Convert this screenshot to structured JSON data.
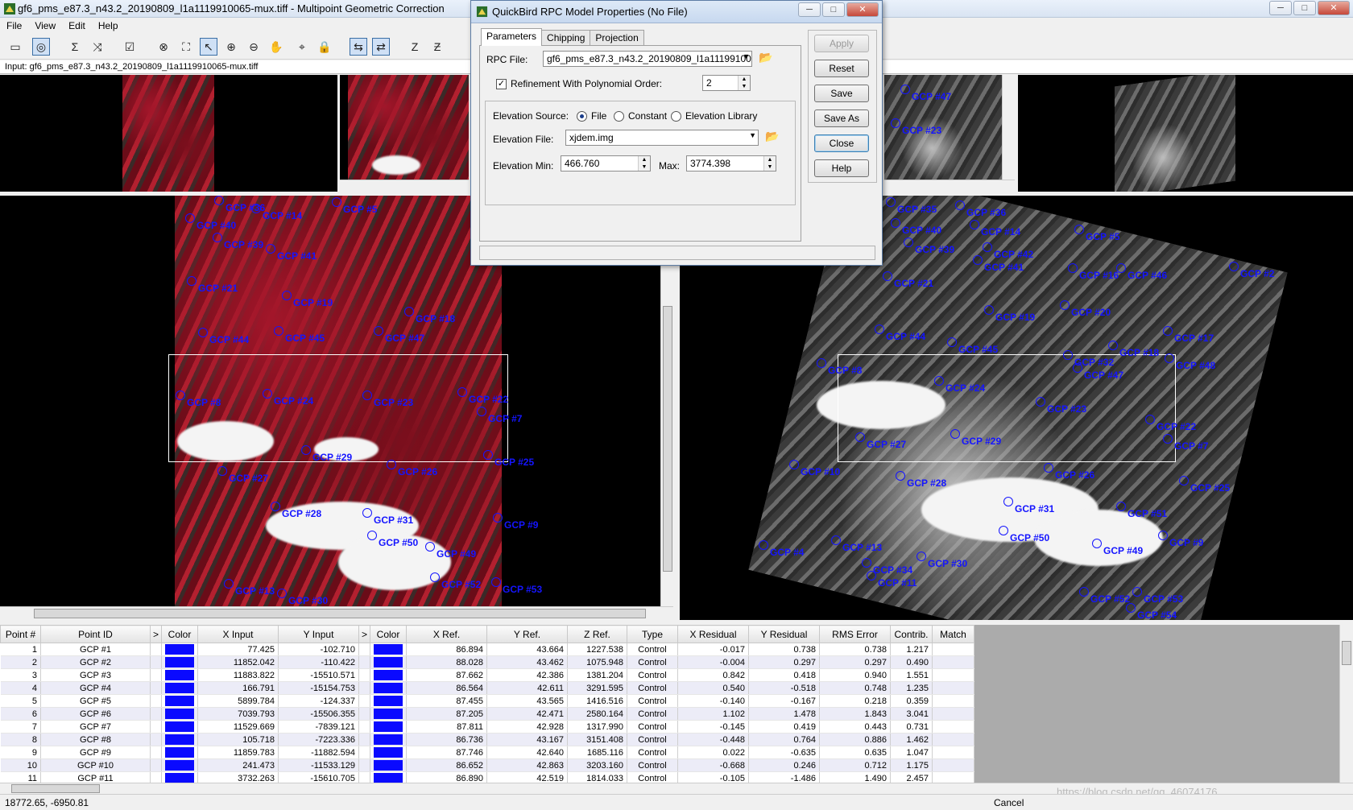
{
  "window": {
    "title": "gf6_pms_e87.3_n43.2_20190809_l1a1119910065-mux.tiff - Multipoint Geometric Correction",
    "minimize": "─",
    "maximize": "□",
    "close": "✕"
  },
  "menu": [
    "File",
    "View",
    "Edit",
    "Help"
  ],
  "toolbar_icons": [
    "new-icon",
    "gcp-view-icon",
    "sigma-icon",
    "warp-icon",
    "check-icon",
    "delete-point-icon",
    "fit-icon",
    "select-arrow-icon",
    "zoom-in-icon",
    "zoom-out-icon",
    "pan-hand-icon",
    "crosshair-icon",
    "lock-icon",
    "link-views-icon",
    "auto-link-icon",
    "z-icon",
    "zz-icon"
  ],
  "toolbar_glyphs": [
    "▭",
    "◎",
    "Σ",
    "⤨",
    "☑",
    "⊗",
    "⛶",
    "↖",
    "⊕",
    "⊖",
    "✋",
    "⌖",
    "🔒",
    "⇆",
    "⇄",
    "Z",
    "Ƶ"
  ],
  "input_label": "Input: gf6_pms_e87.3_n43.2_20190809_l1a1119910065-mux.tiff",
  "gcp_labels_left": [
    "GCP #36",
    "GCP #5",
    "GCP #40",
    "GCP #14",
    "GCP #39",
    "GCP #41",
    "GCP #21",
    "GCP #19",
    "GCP #18",
    "GCP #44",
    "GCP #45",
    "GCP #47",
    "GCP #8",
    "GCP #24",
    "GCP #23",
    "GCP #22",
    "GCP #7",
    "GCP #29",
    "GCP #26",
    "GCP #25",
    "GCP #27",
    "GCP #28",
    "GCP #31",
    "GCP #9",
    "GCP #50",
    "GCP #49",
    "GCP #52",
    "GCP #53",
    "GCP #13",
    "GCP #30"
  ],
  "gcp_labels_right": [
    "GCP #35",
    "GCP #36",
    "GCP #40",
    "GCP #14",
    "GCP #5",
    "GCP #39",
    "GCP #42",
    "GCP #41",
    "GCP #16",
    "GCP #46",
    "GCP #2",
    "GCP #21",
    "GCP #19",
    "GCP #20",
    "GCP #44",
    "GCP #45",
    "GCP #18",
    "GCP #17",
    "GCP #8",
    "GCP #32",
    "GCP #47",
    "GCP #48",
    "GCP #24",
    "GCP #23",
    "GCP #22",
    "GCP #27",
    "GCP #29",
    "GCP #7",
    "GCP #10",
    "GCP #26",
    "GCP #28",
    "GCP #25",
    "GCP #31",
    "GCP #51",
    "GCP #50",
    "GCP #9",
    "GCP #13",
    "GCP #49",
    "GCP #4",
    "GCP #34",
    "GCP #30",
    "GCP #11",
    "GCP #52",
    "GCP #53",
    "GCP #54"
  ],
  "overview_labels": [
    "GCP #47",
    "GCP #23"
  ],
  "table": {
    "columns": [
      "Point #",
      "Point ID",
      ">",
      "Color",
      "X Input",
      "Y Input",
      ">",
      "Color",
      "X Ref.",
      "Y Ref.",
      "Z Ref.",
      "Type",
      "X Residual",
      "Y Residual",
      "RMS Error",
      "Contrib.",
      "Match"
    ],
    "rows": [
      [
        "1",
        "GCP #1",
        "77.425",
        "-102.710",
        "86.894",
        "43.664",
        "1227.538",
        "Control",
        "-0.017",
        "0.738",
        "0.738",
        "1.217",
        ""
      ],
      [
        "2",
        "GCP #2",
        "11852.042",
        "-110.422",
        "88.028",
        "43.462",
        "1075.948",
        "Control",
        "-0.004",
        "0.297",
        "0.297",
        "0.490",
        ""
      ],
      [
        "3",
        "GCP #3",
        "11883.822",
        "-15510.571",
        "87.662",
        "42.386",
        "1381.204",
        "Control",
        "0.842",
        "0.418",
        "0.940",
        "1.551",
        ""
      ],
      [
        "4",
        "GCP #4",
        "166.791",
        "-15154.753",
        "86.564",
        "42.611",
        "3291.595",
        "Control",
        "0.540",
        "-0.518",
        "0.748",
        "1.235",
        ""
      ],
      [
        "5",
        "GCP #5",
        "5899.784",
        "-124.337",
        "87.455",
        "43.565",
        "1416.516",
        "Control",
        "-0.140",
        "-0.167",
        "0.218",
        "0.359",
        ""
      ],
      [
        "6",
        "GCP #6",
        "7039.793",
        "-15506.355",
        "87.205",
        "42.471",
        "2580.164",
        "Control",
        "1.102",
        "1.478",
        "1.843",
        "3.041",
        ""
      ],
      [
        "7",
        "GCP #7",
        "11529.669",
        "-7839.121",
        "87.811",
        "42.928",
        "1317.990",
        "Control",
        "-0.145",
        "0.419",
        "0.443",
        "0.731",
        ""
      ],
      [
        "8",
        "GCP #8",
        "105.718",
        "-7223.336",
        "86.736",
        "43.167",
        "3151.408",
        "Control",
        "-0.448",
        "0.764",
        "0.886",
        "1.462",
        ""
      ],
      [
        "9",
        "GCP #9",
        "11859.783",
        "-11882.594",
        "87.746",
        "42.640",
        "1685.116",
        "Control",
        "0.022",
        "-0.635",
        "0.635",
        "1.047",
        ""
      ],
      [
        "10",
        "GCP #10",
        "241.473",
        "-11533.129",
        "86.652",
        "42.863",
        "3203.160",
        "Control",
        "-0.668",
        "0.246",
        "0.712",
        "1.175",
        ""
      ],
      [
        "11",
        "GCP #11",
        "3732.263",
        "-15610.705",
        "86.890",
        "42.519",
        "1814.033",
        "Control",
        "-0.105",
        "-1.486",
        "1.490",
        "2.457",
        ""
      ]
    ]
  },
  "status": {
    "coords": "18772.65, -6950.81",
    "cancel": "Cancel",
    "watermark": "https://blog.csdn.net/qq_46074176"
  },
  "dialog": {
    "title": "QuickBird RPC Model Properties (No File)",
    "tabs": [
      "Parameters",
      "Chipping",
      "Projection"
    ],
    "rpc_file_label": "RPC File:",
    "rpc_file_value": "gf6_pms_e87.3_n43.2_20190809_l1a1119910065-mux",
    "refinement_label": "Refinement With Polynomial Order:",
    "refinement_checked": "✓",
    "refinement_order": "2",
    "elevation_source_label": "Elevation Source:",
    "source_options": [
      "File",
      "Constant",
      "Elevation Library"
    ],
    "elevation_file_label": "Elevation File:",
    "elevation_file_value": "xjdem.img",
    "elev_min_label": "Elevation Min:",
    "elev_min_value": "466.760",
    "elev_max_label": "Max:",
    "elev_max_value": "3774.398",
    "buttons": [
      "Apply",
      "Reset",
      "Save",
      "Save As",
      "Close",
      "Help"
    ]
  },
  "colors": {
    "gcp": "#1515ff",
    "accent": "#3a6ea5"
  }
}
